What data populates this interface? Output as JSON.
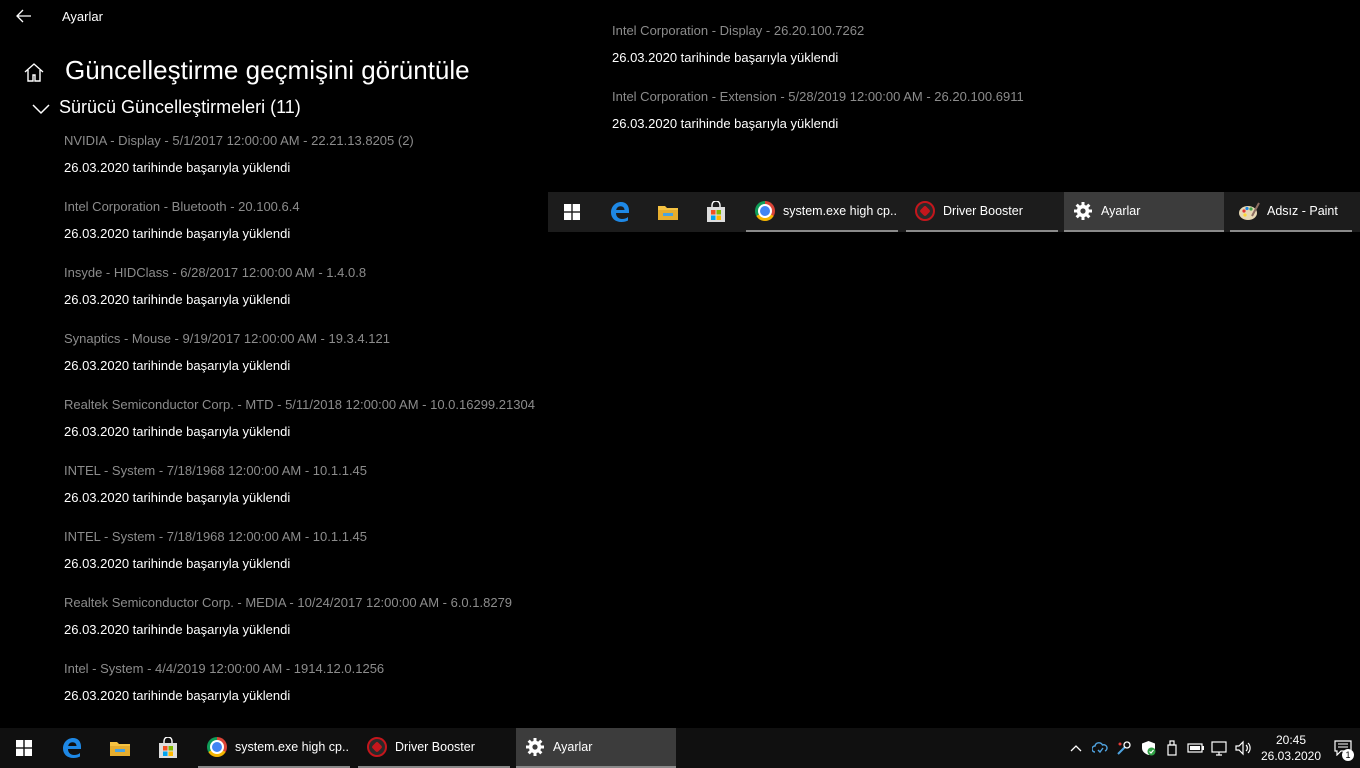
{
  "window": {
    "title": "Ayarlar"
  },
  "page": {
    "title": "Güncelleştirme geçmişini görüntüle"
  },
  "section": {
    "title": "Sürücü Güncelleştirmeleri (11)"
  },
  "updates": [
    {
      "name": "NVIDIA - Display - 5/1/2017 12:00:00 AM - 22.21.13.8205 (2)",
      "status": "26.03.2020 tarihinde başarıyla yüklendi"
    },
    {
      "name": "Intel Corporation - Bluetooth - 20.100.6.4",
      "status": "26.03.2020 tarihinde başarıyla yüklendi"
    },
    {
      "name": "Insyde - HIDClass - 6/28/2017 12:00:00 AM - 1.4.0.8",
      "status": "26.03.2020 tarihinde başarıyla yüklendi"
    },
    {
      "name": "Synaptics - Mouse - 9/19/2017 12:00:00 AM - 19.3.4.121",
      "status": "26.03.2020 tarihinde başarıyla yüklendi"
    },
    {
      "name": "Realtek Semiconductor Corp. - MTD - 5/11/2018 12:00:00 AM - 10.0.16299.21304",
      "status": "26.03.2020 tarihinde başarıyla yüklendi"
    },
    {
      "name": "INTEL - System - 7/18/1968 12:00:00 AM - 10.1.1.45",
      "status": "26.03.2020 tarihinde başarıyla yüklendi"
    },
    {
      "name": "INTEL - System - 7/18/1968 12:00:00 AM - 10.1.1.45",
      "status": "26.03.2020 tarihinde başarıyla yüklendi"
    },
    {
      "name": "Realtek Semiconductor Corp. - MEDIA - 10/24/2017 12:00:00 AM - 6.0.1.8279",
      "status": "26.03.2020 tarihinde başarıyla yüklendi"
    },
    {
      "name": "Intel - System - 4/4/2019 12:00:00 AM - 1914.12.0.1256",
      "status": "26.03.2020 tarihinde başarıyla yüklendi"
    },
    {
      "name": "Intel Corporation - Display - 26.20.100.7262",
      "status": "26.03.2020 tarihinde başarıyla yüklendi"
    },
    {
      "name": "Intel Corporation - Extension - 5/28/2019 12:00:00 AM - 26.20.100.6911",
      "status": "26.03.2020 tarihinde başarıyla yüklendi"
    }
  ],
  "taskbar_top": {
    "apps": [
      {
        "label": "system.exe high cp...",
        "icon": "chrome-icon"
      },
      {
        "label": "Driver Booster",
        "icon": "driver-booster-icon"
      },
      {
        "label": "Ayarlar",
        "icon": "gear-icon"
      },
      {
        "label": "Adsız - Paint",
        "icon": "paint-icon"
      }
    ]
  },
  "taskbar": {
    "apps": [
      {
        "label": "system.exe high cp...",
        "icon": "chrome-icon"
      },
      {
        "label": "Driver Booster",
        "icon": "driver-booster-icon"
      },
      {
        "label": "Ayarlar",
        "icon": "gear-icon"
      }
    ],
    "clock": {
      "time": "20:45",
      "date": "26.03.2020"
    },
    "notification_count": "1"
  },
  "colors": {
    "background": "#000000",
    "secondary_text": "#8c8c8c",
    "taskbar": "#101010",
    "active_app": "#3c3c3c",
    "edge_blue": "#1e88e5",
    "folder_yellow": "#f5c242",
    "defender_green": "#2ea043"
  }
}
